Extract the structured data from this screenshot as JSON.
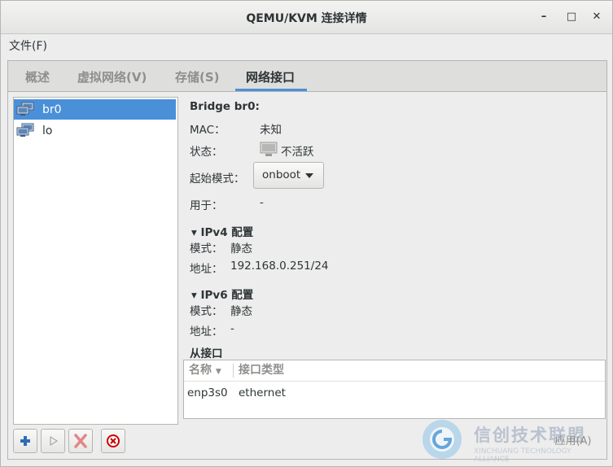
{
  "window": {
    "title": "QEMU/KVM 连接详情"
  },
  "menubar": {
    "file": "文件(F)"
  },
  "tabs": [
    {
      "label": "概述"
    },
    {
      "label": "虚拟网络(V)"
    },
    {
      "label": "存储(S)"
    },
    {
      "label": "网络接口"
    }
  ],
  "interfaces": [
    {
      "name": "br0",
      "selected": true
    },
    {
      "name": "lo",
      "selected": false
    }
  ],
  "details": {
    "header": "Bridge br0:",
    "mac_label": "MAC：",
    "mac_value": "未知",
    "state_label": "状态：",
    "state_value": "不活跃",
    "startmode_label": "起始模式：",
    "startmode_value": "onboot",
    "inuse_label": "用于：",
    "inuse_value": "-",
    "ipv4_header": "IPv4 配置",
    "ipv4_mode_label": "模式：",
    "ipv4_mode_value": "静态",
    "ipv4_addr_label": "地址：",
    "ipv4_addr_value": "192.168.0.251/24",
    "ipv6_header": "IPv6 配置",
    "ipv6_mode_label": "模式：",
    "ipv6_mode_value": "静态",
    "ipv6_addr_label": "地址：",
    "ipv6_addr_value": "-",
    "slave_header": "从接口",
    "slave_columns": [
      "名称",
      "接口类型"
    ],
    "slave_rows": [
      {
        "name": "enp3s0",
        "type": "ethernet"
      }
    ]
  },
  "buttons": {
    "apply": "应用(A)"
  },
  "watermark": {
    "cn": "信创技术联盟",
    "en": "XINCHUANG TECHNOLOGY ALLIANCE"
  },
  "colors": {
    "accent": "#4a90d9",
    "delete_red": "#cc0000"
  },
  "icons": [
    "network-interface-icon",
    "add-icon",
    "play-icon",
    "delete-icon",
    "stop-icon",
    "monitor-icon",
    "chevron-down-icon"
  ]
}
